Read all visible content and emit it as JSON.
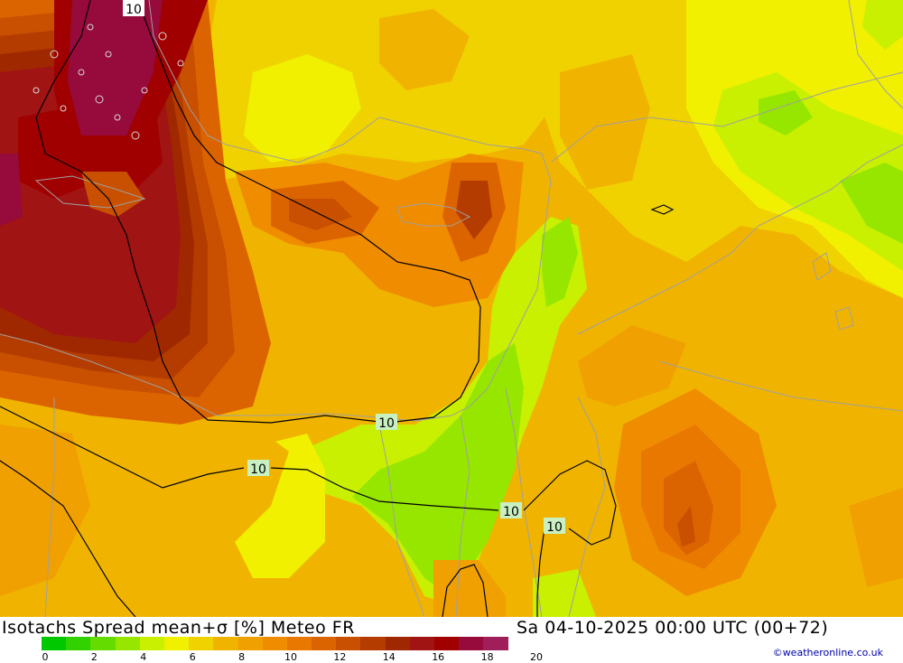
{
  "map": {
    "title": "Isotachs Spread mean+σ [%] Meteo FR",
    "datetime": "Sa 04-10-2025 00:00 UTC (00+72)",
    "credit": "©weatheronline.co.uk",
    "contour_value_label": "10"
  },
  "legend": {
    "colors": [
      "#00c800",
      "#32d200",
      "#64dc00",
      "#96e600",
      "#c8f000",
      "#f0f000",
      "#f0d200",
      "#f0b400",
      "#f0a000",
      "#f08c00",
      "#e87800",
      "#dc6400",
      "#c85000",
      "#b43c00",
      "#a02800",
      "#a01414",
      "#a00000",
      "#960a3c",
      "#a01e5a"
    ],
    "tick_labels": [
      "0",
      "2",
      "4",
      "6",
      "8",
      "10",
      "12",
      "14",
      "16",
      "18",
      "20"
    ]
  }
}
